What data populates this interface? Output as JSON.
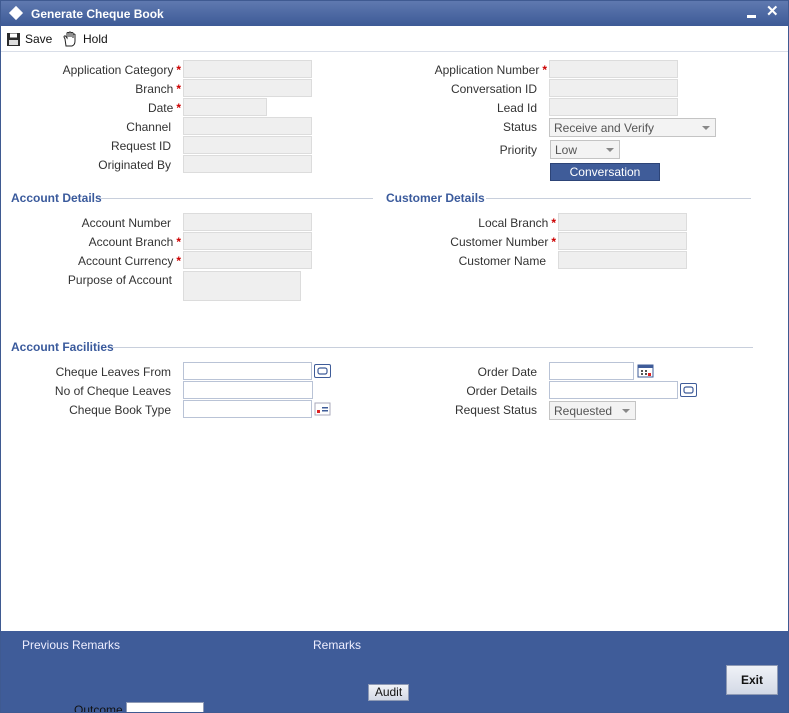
{
  "window": {
    "title": "Generate Cheque Book",
    "minimize": "–",
    "close": "✕"
  },
  "toolbar": {
    "save_label": "Save",
    "hold_label": "Hold"
  },
  "header_left": {
    "application_category": "Application Category",
    "branch": "Branch",
    "date": "Date",
    "channel": "Channel",
    "request_id": "Request ID",
    "originated_by": "Originated By"
  },
  "header_right": {
    "application_number": "Application Number",
    "conversation_id": "Conversation ID",
    "lead_id": "Lead Id",
    "status_label": "Status",
    "status_value": "Receive and Verify",
    "priority_label": "Priority",
    "priority_value": "Low",
    "conversation_button": "Conversation"
  },
  "account_details": {
    "title": "Account Details",
    "account_number": "Account Number",
    "account_branch": "Account Branch",
    "account_currency": "Account Currency",
    "purpose": "Purpose of Account"
  },
  "customer_details": {
    "title": "Customer Details",
    "local_branch": "Local Branch",
    "customer_number": "Customer Number",
    "customer_name": "Customer Name"
  },
  "account_facilities": {
    "title": "Account Facilities",
    "cheque_leaves_from": "Cheque Leaves From",
    "no_of_cheque_leaves": "No of Cheque Leaves",
    "cheque_book_type": "Cheque Book Type",
    "order_date": "Order Date",
    "order_details": "Order Details",
    "request_status_label": "Request Status",
    "request_status_value": "Requested"
  },
  "footer": {
    "previous_remarks": "Previous Remarks",
    "remarks": "Remarks",
    "audit": "Audit",
    "exit": "Exit",
    "outcome": "Outcome"
  },
  "required_mark": "*"
}
